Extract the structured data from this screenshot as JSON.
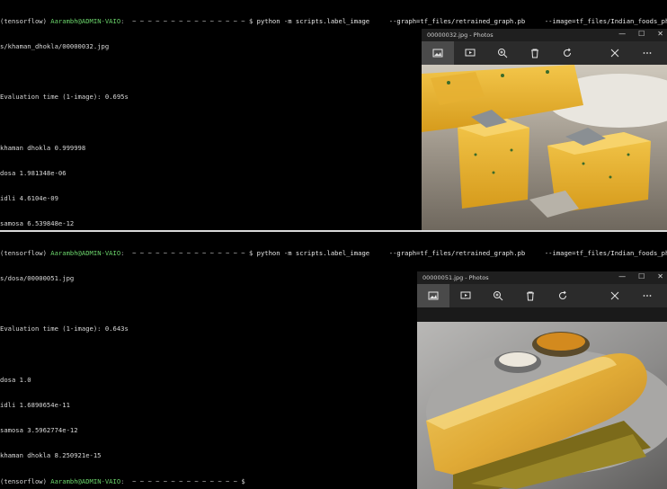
{
  "top_terminal": {
    "prompt_env": "(tensorflow)",
    "prompt_user": "Aarambh@ADMIN-VAIO",
    "prompt_path": ":  ~ ~ ~ ~ ~ ~ ~ ~ ~ ~ ~ ~ ~ ~ ~",
    "prompt_symbol": "$",
    "command": "python -m scripts.label_image     --graph=tf_files/retrained_graph.pb     --image=tf_files/Indian_foods_photos",
    "command_wrap": "s/khaman_dhokla/00000032.jpg",
    "eval_line": "Evaluation time (1-image): 0.695s",
    "results": [
      "khaman dhokla 0.999998",
      "dosa 1.981348e-06",
      "idli 4.6104e-09",
      "samosa 6.539848e-12"
    ],
    "final_prompt_path": ":  ~ ~ ~ ~ ~ ~ ~ ~ ~ ~ ~ ~ ~ ~"
  },
  "bottom_terminal": {
    "prompt_env": "(tensorflow)",
    "prompt_user": "Aarambh@ADMIN-VAIO",
    "prompt_path": ":  ~ ~ ~ ~ ~ ~ ~ ~ ~ ~ ~ ~ ~ ~ ~",
    "prompt_symbol": "$",
    "command": "python -m scripts.label_image     --graph=tf_files/retrained_graph.pb     --image=tf_files/Indian_foods_photos",
    "command_wrap": "s/dosa/00000051.jpg",
    "eval_line": "Evaluation time (1-image): 0.643s",
    "results": [
      "dosa 1.0",
      "idli 1.6890654e-11",
      "samosa 3.5962774e-12",
      "khaman dhokla 8.250921e-15"
    ],
    "final_prompt_path": ":  ~ ~ ~ ~ ~ ~ ~ ~ ~ ~ ~ ~ ~ ~"
  },
  "photo_window_top": {
    "title": "00000032.jpg - Photos",
    "image_subject": "khaman dhokla"
  },
  "photo_window_bottom": {
    "title": "00000051.jpg - Photos",
    "image_subject": "dosa"
  },
  "window_controls": {
    "minimize": "—",
    "maximize": "☐",
    "close": "✕"
  },
  "colors": {
    "user_green": "#6ad36a",
    "terminal_bg": "#000000",
    "photos_toolbar": "#2b2b2b"
  }
}
